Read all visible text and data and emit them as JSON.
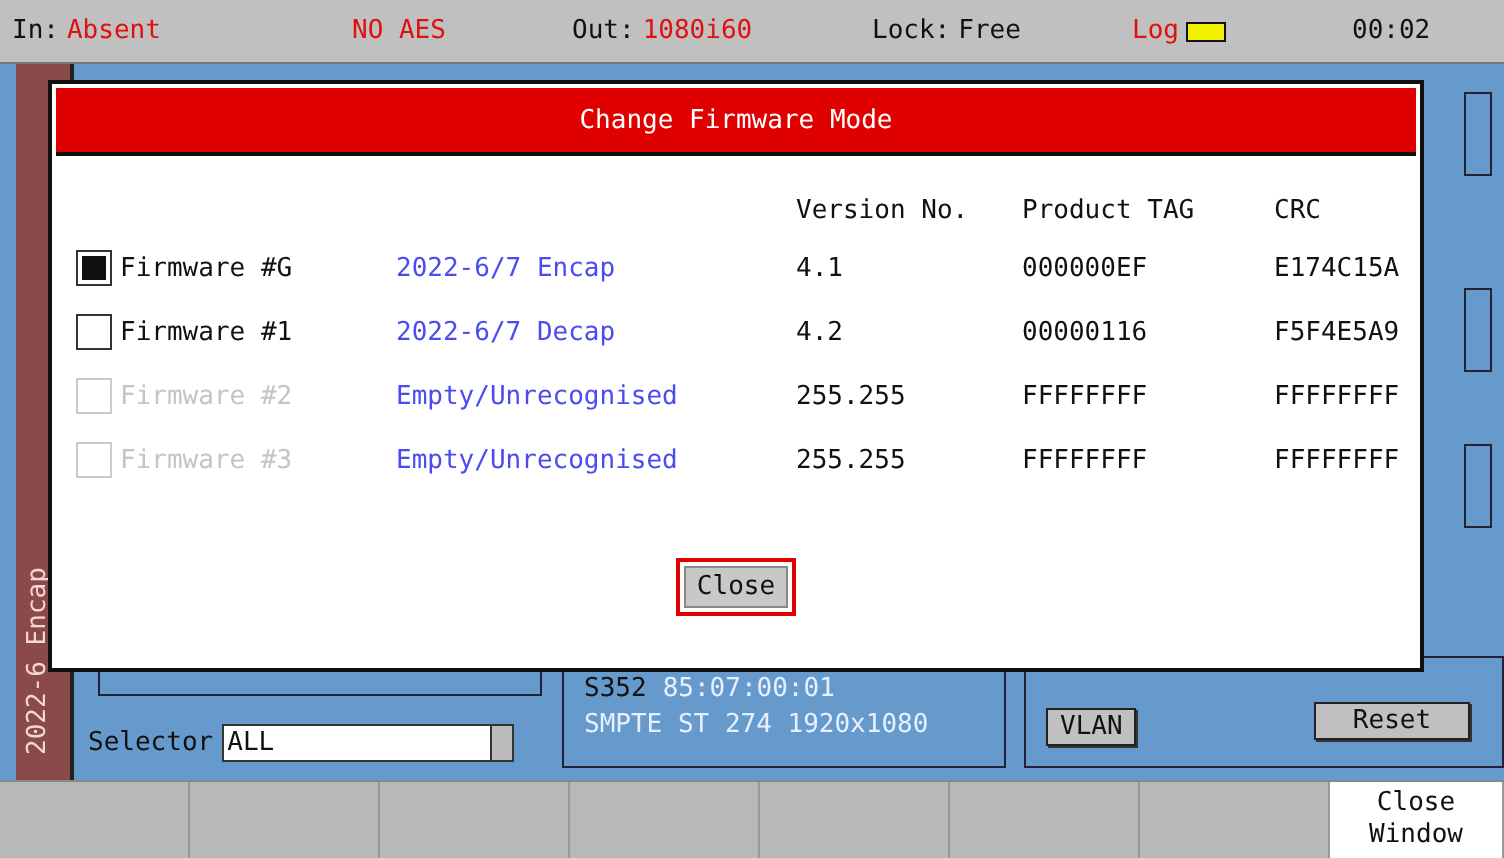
{
  "status_bar": [
    {
      "label": "In:",
      "value": "Absent",
      "alert": true
    },
    {
      "value": "NO AES",
      "alert": true
    },
    {
      "label": "Out:",
      "value": "1080i60",
      "alert": true
    },
    {
      "label": "Lock:",
      "value": "Free",
      "alert": false
    },
    {
      "value": "Log",
      "alert": true,
      "kind": "battery"
    },
    {
      "value": "00:02",
      "alert": false
    }
  ],
  "side_tab": {
    "label": "2022-6 Encap"
  },
  "background": {
    "selector": {
      "label": "Selector",
      "value": "ALL"
    },
    "stream": {
      "line1_label": "S352",
      "line1_value": "85:07:00:01",
      "line2": "SMPTE ST 274 1920x1080"
    },
    "buttons": [
      "VLAN",
      "Reset"
    ]
  },
  "softkeys": [
    {
      "selected": false
    },
    {
      "selected": false
    },
    {
      "selected": false
    },
    {
      "selected": false
    },
    {
      "selected": false
    },
    {
      "selected": false
    },
    {
      "selected": false
    },
    {
      "selected": true,
      "label": "Close Window"
    }
  ],
  "dialog": {
    "title": "Change Firmware Mode",
    "columns": [
      "Version No.",
      "Product TAG",
      "CRC"
    ],
    "rows": [
      {
        "label": "Firmware #G",
        "checked": true,
        "disabled": false,
        "name": "2022-6/7 Encap",
        "version": "4.1",
        "tag": "000000EF",
        "crc": "E174C15A"
      },
      {
        "label": "Firmware #1",
        "checked": false,
        "disabled": false,
        "name": "2022-6/7 Decap",
        "version": "4.2",
        "tag": "00000116",
        "crc": "F5F4E5A9"
      },
      {
        "label": "Firmware #2",
        "checked": false,
        "disabled": true,
        "name": "Empty/Unrecognised",
        "version": "255.255",
        "tag": "FFFFFFFF",
        "crc": "FFFFFFFF"
      },
      {
        "label": "Firmware #3",
        "checked": false,
        "disabled": true,
        "name": "Empty/Unrecognised",
        "version": "255.255",
        "tag": "FFFFFFFF",
        "crc": "FFFFFFFF"
      }
    ],
    "close_button": "Close"
  }
}
